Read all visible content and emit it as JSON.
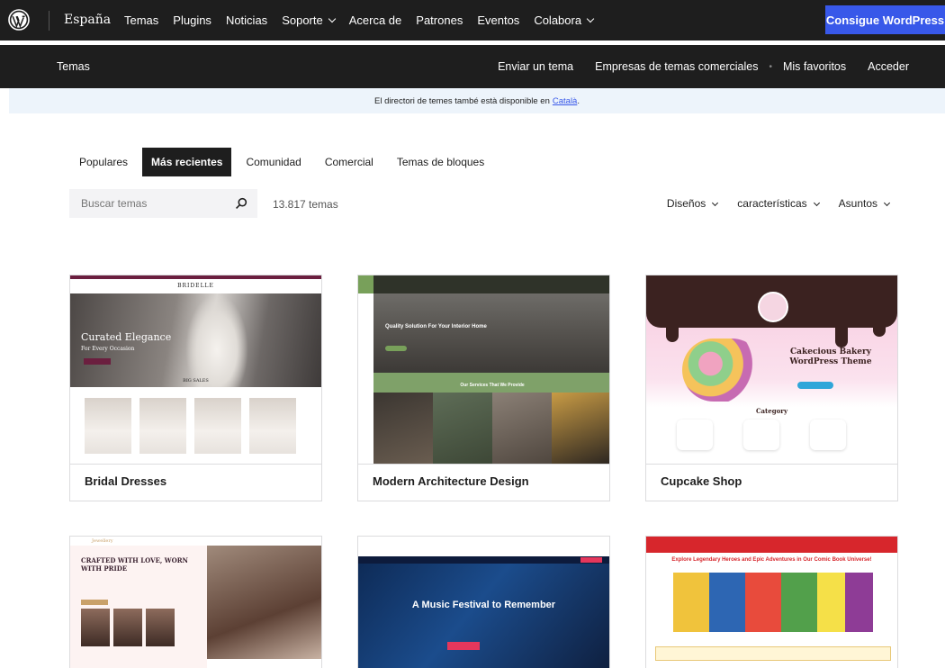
{
  "global_header": {
    "site_name": "España",
    "nav": [
      "Temas",
      "Plugins",
      "Noticias",
      "Soporte",
      "Acerca de",
      "Patrones",
      "Eventos",
      "Colabora"
    ],
    "cta": "Consigue WordPress"
  },
  "local_nav": {
    "title": "Temas",
    "links": [
      "Enviar un tema",
      "Empresas de temas comerciales",
      "Mis favoritos",
      "Acceder"
    ]
  },
  "notice": {
    "text": "El directori de temes també està disponible en",
    "link": "Català",
    "suffix": "."
  },
  "tabs": [
    {
      "label": "Populares",
      "active": false
    },
    {
      "label": "Más recientes",
      "active": true
    },
    {
      "label": "Comunidad",
      "active": false
    },
    {
      "label": "Comercial",
      "active": false
    },
    {
      "label": "Temas de bloques",
      "active": false
    }
  ],
  "search": {
    "placeholder": "Buscar temas",
    "value": ""
  },
  "count": "13.817 temas",
  "filters": [
    "Diseños",
    "características",
    "Asuntos"
  ],
  "themes": [
    {
      "name": "Bridal Dresses",
      "preview": {
        "brand": "BRIDELLE",
        "headline": "Curated Elegance",
        "subline": "For Every Occasion",
        "section": "BIG SALES"
      }
    },
    {
      "name": "Modern Architecture Design",
      "preview": {
        "headline": "Quality Solution For Your Interior Home",
        "band": "Our Services That We Provide"
      }
    },
    {
      "name": "Cupcake Shop",
      "preview": {
        "headline": "Cakecious Bakery WordPress Theme",
        "section": "Category"
      }
    },
    {
      "name": "",
      "preview": {
        "brand": "Jewellery",
        "headline": "CRAFTED WITH LOVE, WORN WITH PRIDE"
      }
    },
    {
      "name": "",
      "preview": {
        "headline": "A Music Festival to Remember"
      }
    },
    {
      "name": "",
      "preview": {
        "headline": "Explore Legendary Heroes and Epic Adventures in Our Comic Book Universe!"
      }
    }
  ],
  "colors": {
    "header_bg": "#1e1e1e",
    "cta": "#3858e9",
    "notice_bg": "#edf4fb",
    "active_tab": "#1e1e1e"
  }
}
